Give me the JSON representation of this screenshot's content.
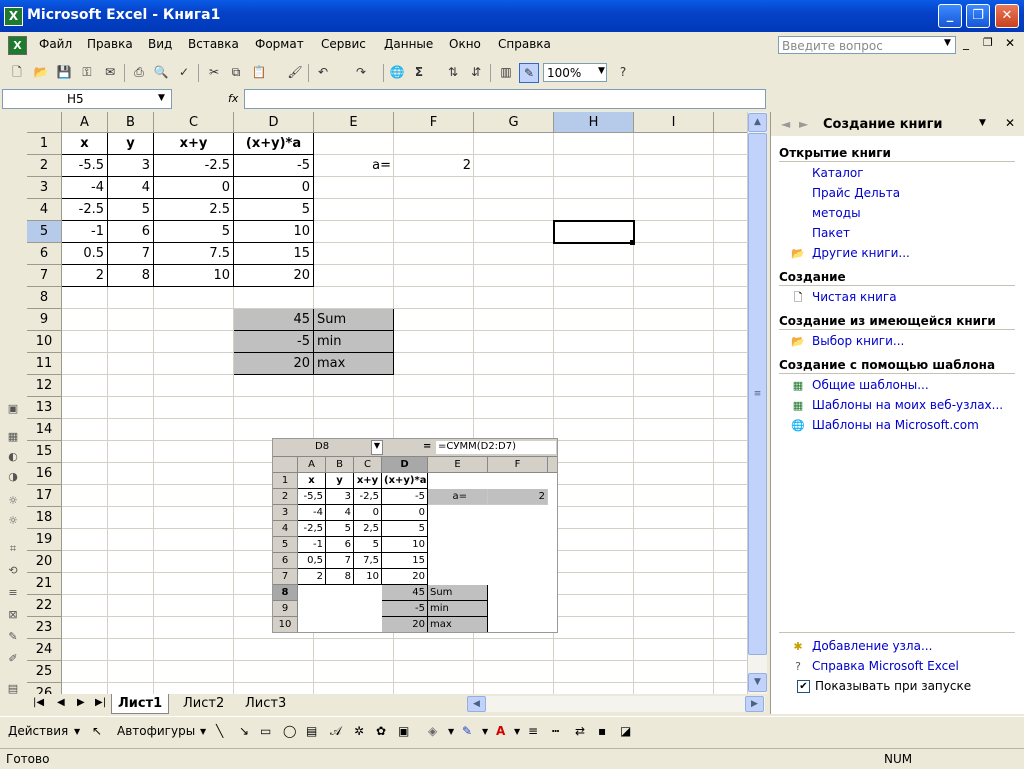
{
  "window": {
    "title": "Microsoft Excel - Книга1"
  },
  "menu": [
    "Файл",
    "Правка",
    "Вид",
    "Вставка",
    "Формат",
    "Сервис",
    "Данные",
    "Окно",
    "Справка"
  ],
  "help_placeholder": "Введите вопрос",
  "toolbar": {
    "zoom": "100%"
  },
  "formula_bar": {
    "name_box": "H5",
    "fx_label": "fx",
    "formula": ""
  },
  "grid": {
    "columns": [
      "A",
      "B",
      "C",
      "D",
      "E",
      "F",
      "G",
      "H",
      "I"
    ],
    "selected_column": "H",
    "rows": [
      "1",
      "2",
      "3",
      "4",
      "5",
      "6",
      "7",
      "8",
      "9",
      "10",
      "11",
      "12",
      "13",
      "14",
      "15",
      "16",
      "17",
      "18",
      "19",
      "20",
      "21",
      "22",
      "23",
      "24",
      "25",
      "26"
    ],
    "selected_row": "5",
    "headers": [
      "x",
      "y",
      "x+y",
      "(x+y)*a"
    ],
    "data": [
      [
        "-5.5",
        "3",
        "-2.5",
        "-5"
      ],
      [
        "-4",
        "4",
        "0",
        "0"
      ],
      [
        "-2.5",
        "5",
        "2.5",
        "5"
      ],
      [
        "-1",
        "6",
        "5",
        "10"
      ],
      [
        "0.5",
        "7",
        "7.5",
        "15"
      ],
      [
        "2",
        "8",
        "10",
        "20"
      ]
    ],
    "a_label": "a=",
    "a_value": "2",
    "summary": [
      {
        "value": "45",
        "label": "Sum"
      },
      {
        "value": "-5",
        "label": "min"
      },
      {
        "value": "20",
        "label": "max"
      }
    ]
  },
  "embedded": {
    "name_box": "D8",
    "eq": "=",
    "formula": "=СУММ(D2:D7)",
    "columns": [
      "A",
      "B",
      "C",
      "D",
      "E",
      "F"
    ],
    "rows": [
      "1",
      "2",
      "3",
      "4",
      "5",
      "6",
      "7",
      "8",
      "9",
      "10"
    ],
    "headers": [
      "x",
      "y",
      "x+y",
      "(x+y)*a"
    ],
    "data": [
      [
        "-5,5",
        "3",
        "-2,5",
        "-5"
      ],
      [
        "-4",
        "4",
        "0",
        "0"
      ],
      [
        "-2,5",
        "5",
        "2,5",
        "5"
      ],
      [
        "-1",
        "6",
        "5",
        "10"
      ],
      [
        "0,5",
        "7",
        "7,5",
        "15"
      ],
      [
        "2",
        "8",
        "10",
        "20"
      ]
    ],
    "a_label": "a=",
    "a_value": "2",
    "summary": [
      {
        "value": "45",
        "label": "Sum"
      },
      {
        "value": "-5",
        "label": "min"
      },
      {
        "value": "20",
        "label": "max"
      }
    ]
  },
  "sheet_tabs": [
    "Лист1",
    "Лист2",
    "Лист3"
  ],
  "task_pane": {
    "title": "Создание книги",
    "open_section": "Открытие книги",
    "open_links": [
      "Каталог",
      "Прайс Дельта",
      "методы",
      "Пакет",
      "Другие книги..."
    ],
    "new_section": "Создание",
    "new_link": "Чистая книга",
    "existing_section": "Создание из имеющейся книги",
    "existing_link": "Выбор книги...",
    "template_section": "Создание с помощью шаблона",
    "template_links": [
      "Общие шаблоны...",
      "Шаблоны на моих веб-узлах...",
      "Шаблоны на Microsoft.com"
    ],
    "footer_links": [
      "Добавление узла...",
      "Справка Microsoft Excel"
    ],
    "show_on_startup": "Показывать при запуске"
  },
  "drawing_toolbar": {
    "actions": "Действия",
    "autoshapes": "Автофигуры"
  },
  "status": {
    "ready": "Готово",
    "num": "NUM"
  }
}
